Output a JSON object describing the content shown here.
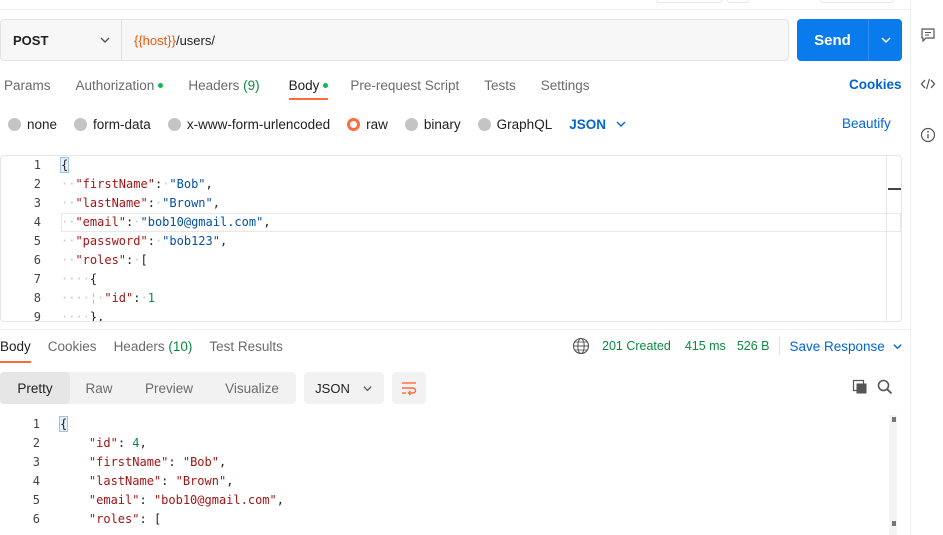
{
  "request": {
    "method": "POST",
    "url_var": "{{host}}",
    "url_path": "/users/",
    "send_label": "Send"
  },
  "req_tabs": [
    {
      "label": "Params"
    },
    {
      "label": "Authorization"
    },
    {
      "label": "Headers",
      "count": "(9)"
    },
    {
      "label": "Body"
    },
    {
      "label": "Pre-request Script"
    },
    {
      "label": "Tests"
    },
    {
      "label": "Settings"
    }
  ],
  "cookies_label": "Cookies",
  "body_types": [
    "none",
    "form-data",
    "x-www-form-urlencoded",
    "raw",
    "binary",
    "GraphQL"
  ],
  "body_language": "JSON",
  "beautify_label": "Beautify",
  "request_body": {
    "line_numbers": [
      "1",
      "2",
      "3",
      "4",
      "5",
      "6",
      "7",
      "8",
      "9"
    ],
    "lines": {
      "l1": "{",
      "l2_key": "\"firstName\"",
      "l2_val": "\"Bob\"",
      "l3_key": "\"lastName\"",
      "l3_val": "\"Brown\"",
      "l4_key": "\"email\"",
      "l4_val": "\"bob10@gmail.com\"",
      "l5_key": "\"password\"",
      "l5_val": "\"bob123\"",
      "l6_key": "\"roles\"",
      "l6_val": "[",
      "l7": "{",
      "l8_key": "\"id\"",
      "l8_val": "1",
      "l9": "},"
    }
  },
  "resp_tabs": [
    {
      "label": "Body"
    },
    {
      "label": "Cookies"
    },
    {
      "label": "Headers",
      "count": "(10)"
    },
    {
      "label": "Test Results"
    }
  ],
  "response_meta": {
    "status": "201 Created",
    "time": "415 ms",
    "size": "526 B",
    "save_label": "Save Response"
  },
  "view_modes": [
    "Pretty",
    "Raw",
    "Preview",
    "Visualize"
  ],
  "response_language": "JSON",
  "response_body": {
    "line_numbers": [
      "1",
      "2",
      "3",
      "4",
      "5",
      "6"
    ],
    "lines": {
      "l1": "{",
      "l2_key": "\"id\"",
      "l2_val": "4",
      "l3_key": "\"firstName\"",
      "l3_val": "\"Bob\"",
      "l4_key": "\"lastName\"",
      "l4_val": "\"Brown\"",
      "l5_key": "\"email\"",
      "l5_val": "\"bob10@gmail.com\"",
      "l6_key": "\"roles\"",
      "l6_val": "["
    }
  },
  "colors": {
    "accent_orange": "#ff6c37",
    "send_blue": "#097bed",
    "link_blue": "#0265d2",
    "status_green": "#0a8a3e"
  }
}
